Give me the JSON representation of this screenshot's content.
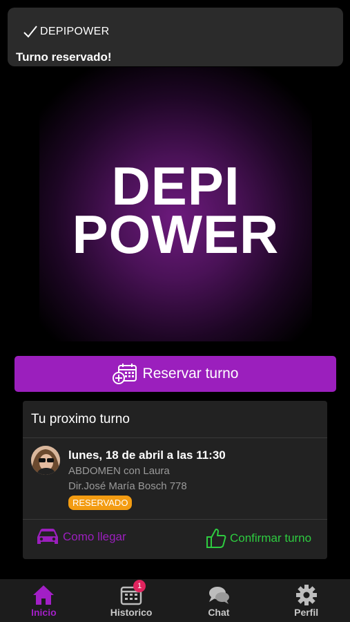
{
  "toast": {
    "app_name": "DEPIPOWER",
    "message": "Turno reservado!",
    "icon": "check-icon"
  },
  "logo": {
    "line1": "DEPI",
    "line2": "POWER"
  },
  "reserve_button": {
    "label": "Reservar turno",
    "icon": "calendar-add-icon"
  },
  "next_appointment": {
    "title": "Tu proximo turno",
    "date": "lunes, 18 de abril a las 11:30",
    "service": "ABDOMEN con Laura",
    "address": "Dir.José María Bosch 778",
    "status": "RESERVADO",
    "actions": {
      "how_to_get": "Como llegar",
      "confirm": "Confirmar turno"
    }
  },
  "bottom_nav": {
    "items": [
      {
        "label": "Inicio",
        "icon": "home-icon",
        "active": true
      },
      {
        "label": "Historico",
        "icon": "calendar-icon",
        "badge": "1"
      },
      {
        "label": "Chat",
        "icon": "chat-icon"
      },
      {
        "label": "Perfil",
        "icon": "gear-icon"
      }
    ]
  },
  "colors": {
    "accent": "#9b1fbd",
    "success": "#2ecc40",
    "status_badge": "#f39c12",
    "notification_badge": "#e0245e"
  }
}
